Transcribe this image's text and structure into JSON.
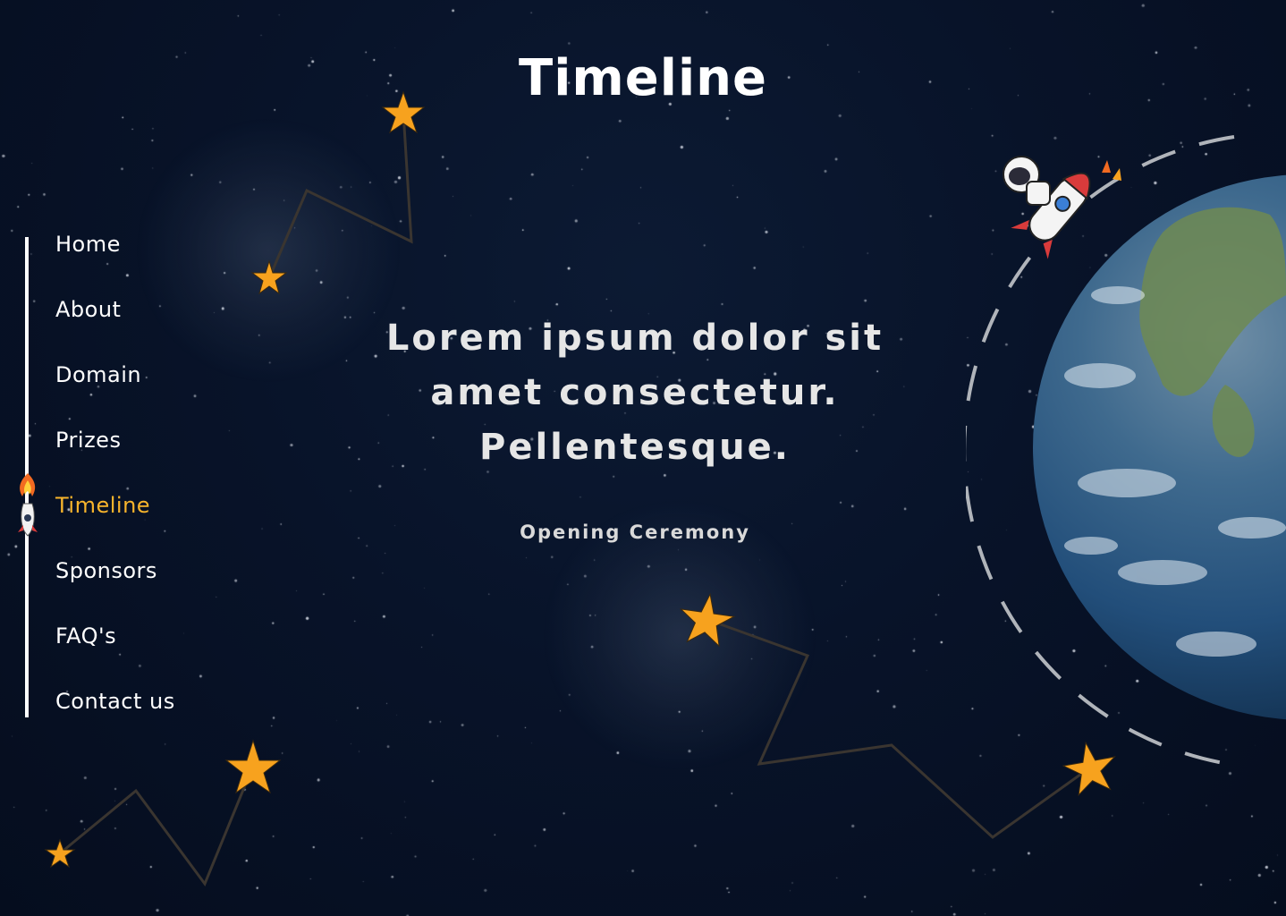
{
  "page": {
    "title": "Timeline"
  },
  "nav": {
    "items": [
      {
        "label": "Home",
        "active": false
      },
      {
        "label": "About",
        "active": false
      },
      {
        "label": "Domain",
        "active": false
      },
      {
        "label": "Prizes",
        "active": false
      },
      {
        "label": "Timeline",
        "active": true
      },
      {
        "label": "Sponsors",
        "active": false
      },
      {
        "label": "FAQ's",
        "active": false
      },
      {
        "label": "Contact us",
        "active": false
      }
    ]
  },
  "main": {
    "headline": "Lorem ipsum dolor sit amet consectetur. Pellentesque.",
    "event": "Opening Ceremony"
  },
  "colors": {
    "background": "#050d1e",
    "accent": "#f7b42c",
    "star": "#f7a21e",
    "text": "#ffffff"
  },
  "icons": {
    "nav_marker": "rocket-icon",
    "decoration": [
      "star-icon",
      "earth-icon",
      "astronaut-icon"
    ]
  }
}
